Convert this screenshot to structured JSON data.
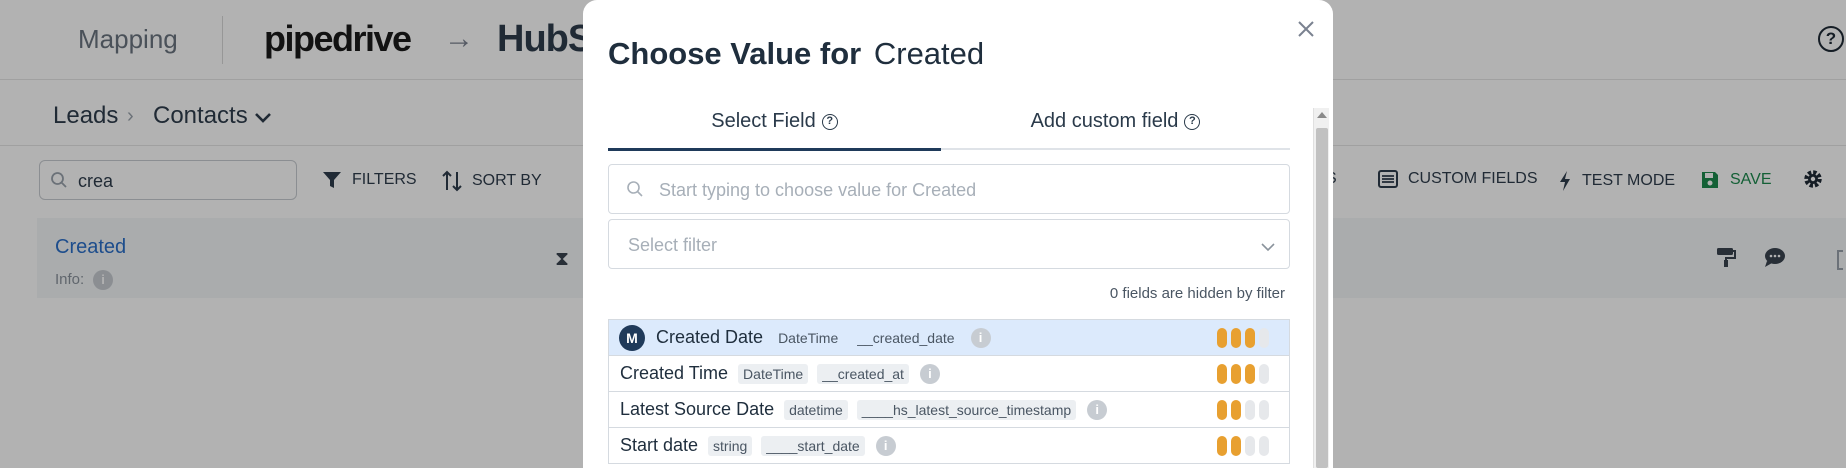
{
  "app": {
    "topbar": {
      "section_title": "Mapping",
      "source_logo": "pipedrive",
      "arrow": "→",
      "target_logo": "HubS",
      "help_label": "?"
    },
    "breadcrumb": {
      "level1": "Leads",
      "separator": "›",
      "level2": "Contacts"
    },
    "toolbar": {
      "search_value": "crea",
      "filters_label": "FILTERS",
      "sort_label": "SORT BY",
      "partial_label": "S",
      "custom_fields_label": "CUSTOM FIELDS",
      "test_mode_label": "TEST MODE",
      "save_label": "SAVE"
    },
    "field_row": {
      "title": "Created",
      "info_label": "Info:",
      "info_icon_label": "i"
    }
  },
  "modal": {
    "title_bold": "Choose Value for",
    "title_value": "Created",
    "tabs": [
      {
        "label": "Select Field",
        "active": true
      },
      {
        "label": "Add custom field",
        "active": false
      }
    ],
    "tab_help_label": "?",
    "search_placeholder": "Start typing to choose value for Created",
    "filter_placeholder": "Select filter",
    "hidden_note": "0 fields are hidden by filter",
    "items": [
      {
        "badge": "M",
        "name": "Created Date",
        "type": "DateTime",
        "key": "__created_date",
        "info": "i",
        "score": 3,
        "selected": true
      },
      {
        "name": "Created Time",
        "type": "DateTime",
        "key": "__created_at",
        "info": "i",
        "score": 3,
        "selected": false
      },
      {
        "name": "Latest Source Date",
        "type": "datetime",
        "key": "____hs_latest_source_timestamp",
        "info": "i",
        "score": 2,
        "selected": false
      },
      {
        "name": "Start date",
        "type": "string",
        "key": "____start_date",
        "info": "i",
        "score": 2,
        "selected": false
      }
    ],
    "score_max": 4
  },
  "colors": {
    "accent": "#1f3a5a",
    "score_on": "#e8a030",
    "selected_row": "#dceafc",
    "save_green": "#1d8a4e",
    "link_blue": "#2a6fc9"
  },
  "icons": {
    "close": "close-icon",
    "search": "search-icon",
    "chevron": "chevron-down-icon",
    "filter": "filter-icon",
    "sort": "sort-icon",
    "custom_fields": "list-icon",
    "test_mode": "bolt-icon",
    "save": "floppy-icon",
    "settings": "gear-icon"
  }
}
